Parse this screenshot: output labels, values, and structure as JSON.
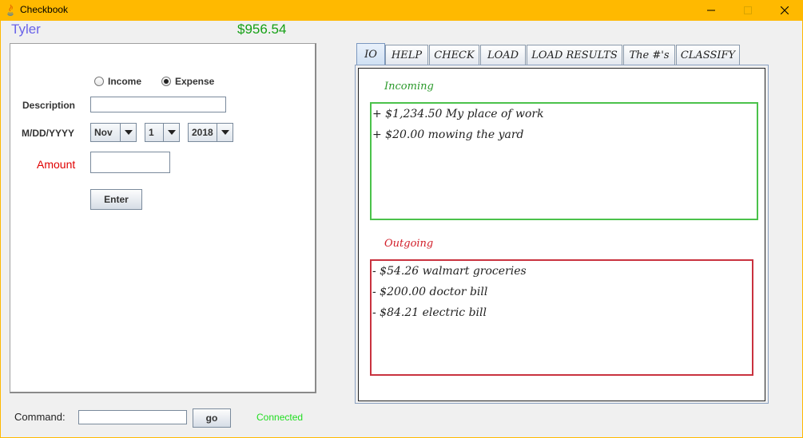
{
  "window": {
    "title": "Checkbook",
    "accent_color": "#ffb900"
  },
  "header": {
    "user_name": "Tyler",
    "balance": "$956.54"
  },
  "form": {
    "income_label": "Income",
    "expense_label": "Expense",
    "selected_type": "Expense",
    "description_label": "Description",
    "description_value": "",
    "date_label": "M/DD/YYYY",
    "month": "Nov",
    "day": "1",
    "year": "2018",
    "amount_label": "Amount",
    "amount_value": "",
    "enter_label": "Enter"
  },
  "command": {
    "label": "Command:",
    "value": "",
    "go_label": "go",
    "status": "Connected"
  },
  "tabs": [
    {
      "label": "IO",
      "active": true
    },
    {
      "label": "HELP",
      "active": false
    },
    {
      "label": "CHECK",
      "active": false
    },
    {
      "label": "LOAD",
      "active": false
    },
    {
      "label": "LOAD RESULTS",
      "active": false
    },
    {
      "label": "The #'s",
      "active": false
    },
    {
      "label": "CLASSIFY",
      "active": false
    }
  ],
  "io": {
    "incoming_label": "Incoming",
    "incoming": [
      "+ $1,234.50 My place of work",
      "+ $20.00 mowing the yard"
    ],
    "outgoing_label": "Outgoing",
    "outgoing": [
      "- $54.26 walmart groceries",
      "- $200.00 doctor bill",
      "- $84.21 electric bill"
    ]
  }
}
